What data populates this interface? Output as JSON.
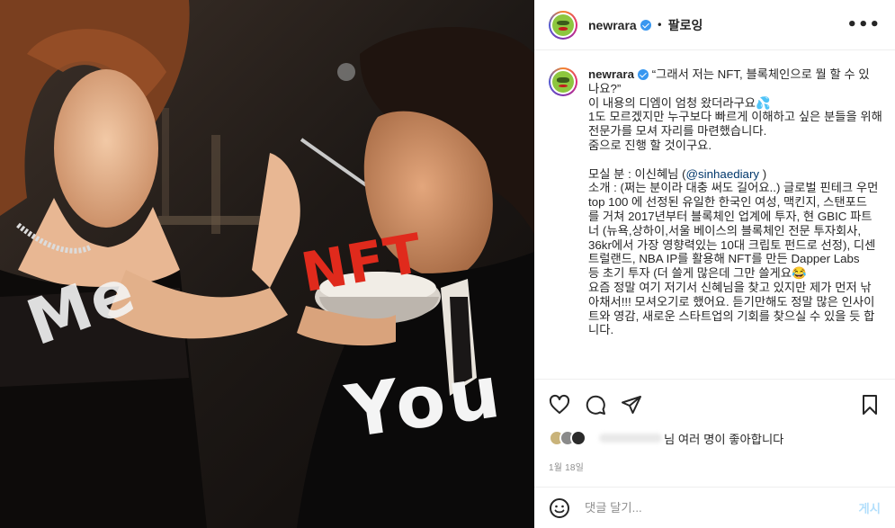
{
  "photo": {
    "overlay_text_me": "Me",
    "overlay_text_nft": "NFT",
    "overlay_text_you": "You"
  },
  "header": {
    "username": "newrara",
    "separator": "•",
    "follow_label": "팔로잉",
    "more_label": "•••"
  },
  "caption": {
    "username": "newrara",
    "lines": [
      "“그래서 저는 NFT, 블록체인으로 뭘 할 수 있",
      "나요?” ⠀",
      "이 내용의 디엠이 엄청 왔더라구요💦",
      "1도 모르겠지만 누구보다 빠르게 이해하고 싶은 분들을 위해",
      "전문가를 모셔 자리를 마련했습니다.⠀",
      "줌으로 진행 할 것이구요.⠀",
      "⠀",
      "모실 분 : 이신혜님 (@sinhaediary )⠀",
      "소개 : (쩌는 분이라 대충 써도 길어요..) 글로벌 핀테크 우먼",
      "top 100 에 선정된 유일한 한국인 여성, 맥킨지, 스탠포드",
      "를 거쳐 2017년부터 블록체인 업계에 투자, 현 GBIC 파트",
      "너 (뉴욕,상하이,서울 베이스의 블록체인 전문 투자회사,",
      "36kr에서 가장 영향력있는 10대 크립토 펀드로 선정), 디센",
      "트럴랜드, NBA IP를 활용해 NFT를 만든 Dapper Labs",
      "등 초기 투자 (더 쓸게 많은데 그만 쓸게요😂⠀",
      "요즘 정말 여기 저기서 신혜님을 찾고 있지만 제가 먼저 낚",
      "아채서!!! 모셔오기로 했어요. 듣기만해도 정말 많은 인사이",
      "트와 영감, 새로운 스타트업의 기회를 찾으실 수 있을 듯 합",
      "니다. ⠀"
    ]
  },
  "likes": {
    "text": "님 여러 명이 좋아합니다"
  },
  "date": "1월 18일",
  "comment": {
    "placeholder": "댓글 달기...",
    "post_label": "게시"
  },
  "colors": {
    "verified": "#3897f0",
    "mention": "#00376b",
    "post_disabled": "#b2dffc"
  }
}
